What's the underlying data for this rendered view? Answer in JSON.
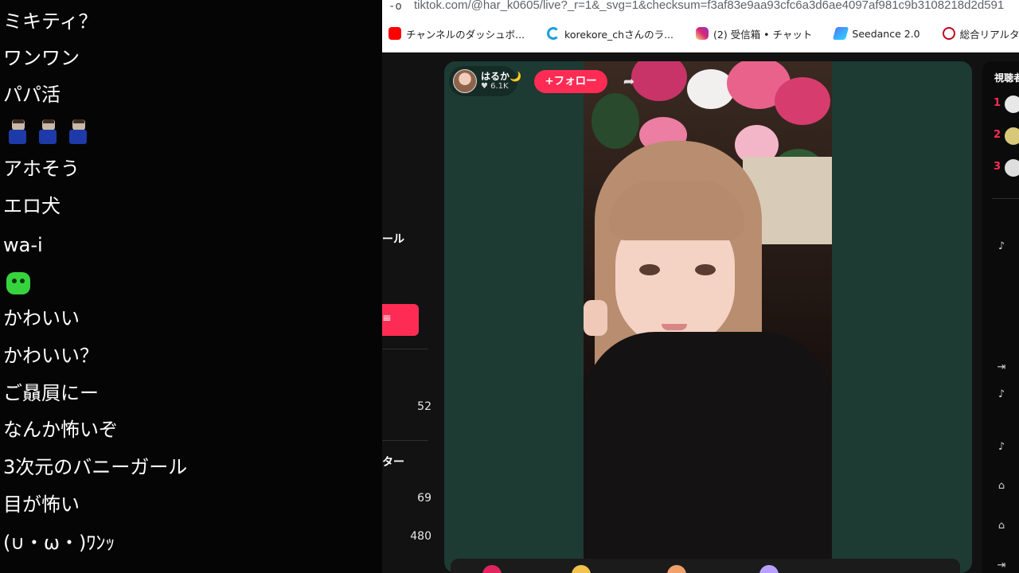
{
  "comments": [
    {
      "text": "ミキティ？"
    },
    {
      "text": "ワンワン"
    },
    {
      "text": "パパ活"
    },
    {
      "text": "アホそう"
    },
    {
      "text": "エロ犬"
    },
    {
      "text": "wa-i"
    },
    {
      "text": "かわいい"
    },
    {
      "text": "かわいい？"
    },
    {
      "text": "ご贔屓にー"
    },
    {
      "text": "なんか怖いぞ"
    },
    {
      "text": "3次元のバニーガール"
    },
    {
      "text": "目が怖い"
    },
    {
      "text": "(∪・ω・)ﾜﾝｯ"
    }
  ],
  "browser": {
    "url_icon": "-o",
    "url": "tiktok.com/@har_k0605/live?_r=1&_svg=1&checksum=f3af83e9aa93cfc6a3d6ae4097af981c9b3108218d2d591",
    "bookmarks": [
      {
        "label": "チャンネルのダッシュボ...",
        "icon": "youtube-icon"
      },
      {
        "label": "korekore_chさんのラ...",
        "icon": "korekore-icon"
      },
      {
        "label": "(2) 受信箱 • チャット",
        "icon": "instagram-icon"
      },
      {
        "label": "Seedance 2.0",
        "icon": "seedance-icon"
      },
      {
        "label": "総合リアルタイムランキ...",
        "icon": "ranking-icon"
      }
    ]
  },
  "left_panel": {
    "text_1": "ール",
    "button_label": "≡",
    "num_1": "52",
    "text_2": "ター",
    "num_2": "69",
    "num_3": "480"
  },
  "live": {
    "host_name": "はるか🌙",
    "host_likes": "♥ 6.1K",
    "follow_label": "+フォロー",
    "share_icon": "➦"
  },
  "viewers": {
    "title": "視聴者",
    "ranks": [
      "1",
      "2",
      "3"
    ]
  },
  "colors": {
    "accent": "#fe2c55",
    "stage_bg": "#1d3a33"
  }
}
